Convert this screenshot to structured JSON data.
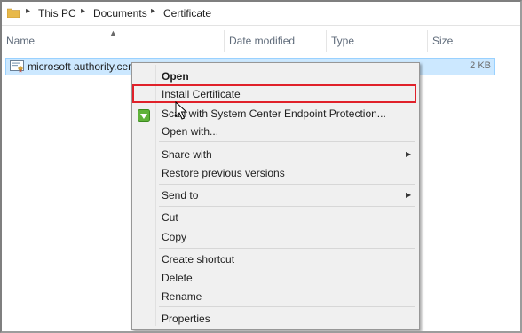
{
  "breadcrumb": [
    "This PC",
    "Documents",
    "Certificate"
  ],
  "columns": {
    "name": "Name",
    "date_modified": "Date modified",
    "type": "Type",
    "size": "Size"
  },
  "file": {
    "name": "microsoft authority.cer",
    "size": "2 KB"
  },
  "context_menu": {
    "items": [
      {
        "label": "Open"
      },
      {
        "label": "Install Certificate"
      },
      {
        "label": "Scan with System Center Endpoint Protection..."
      },
      {
        "label": "Open with..."
      },
      {
        "label": "Share with"
      },
      {
        "label": "Restore previous versions"
      },
      {
        "label": "Send to"
      },
      {
        "label": "Cut"
      },
      {
        "label": "Copy"
      },
      {
        "label": "Create shortcut"
      },
      {
        "label": "Delete"
      },
      {
        "label": "Rename"
      },
      {
        "label": "Properties"
      }
    ]
  },
  "icons": {
    "folder": "folder-icon",
    "certificate_file": "certificate-file-icon",
    "shield": "endpoint-protection-icon",
    "submenu_arrow": "submenu-arrow-icon",
    "cursor": "mouse-cursor-icon"
  },
  "colors": {
    "selection_fill": "#cce8ff",
    "selection_border": "#99d1ff",
    "highlight_box": "#e0212a",
    "menu_background": "#f0f0f0"
  }
}
